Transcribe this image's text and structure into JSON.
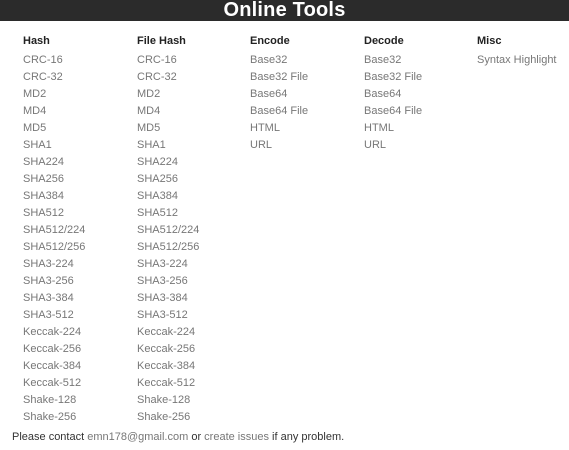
{
  "header": {
    "title": "Online Tools"
  },
  "hash": {
    "title": "Hash",
    "items": [
      "CRC-16",
      "CRC-32",
      "MD2",
      "MD4",
      "MD5",
      "SHA1",
      "SHA224",
      "SHA256",
      "SHA384",
      "SHA512",
      "SHA512/224",
      "SHA512/256",
      "SHA3-224",
      "SHA3-256",
      "SHA3-384",
      "SHA3-512",
      "Keccak-224",
      "Keccak-256",
      "Keccak-384",
      "Keccak-512",
      "Shake-128",
      "Shake-256"
    ]
  },
  "file_hash": {
    "title": "File Hash",
    "items": [
      "CRC-16",
      "CRC-32",
      "MD2",
      "MD4",
      "MD5",
      "SHA1",
      "SHA224",
      "SHA256",
      "SHA384",
      "SHA512",
      "SHA512/224",
      "SHA512/256",
      "SHA3-224",
      "SHA3-256",
      "SHA3-384",
      "SHA3-512",
      "Keccak-224",
      "Keccak-256",
      "Keccak-384",
      "Keccak-512",
      "Shake-128",
      "Shake-256"
    ]
  },
  "encode": {
    "title": "Encode",
    "items": [
      "Base32",
      "Base32 File",
      "Base64",
      "Base64 File",
      "HTML",
      "URL"
    ]
  },
  "decode": {
    "title": "Decode",
    "items": [
      "Base32",
      "Base32 File",
      "Base64",
      "Base64 File",
      "HTML",
      "URL"
    ]
  },
  "misc": {
    "title": "Misc",
    "items": [
      "Syntax Highlight"
    ]
  },
  "footer": {
    "prefix": "Please contact ",
    "email": "emn178@gmail.com",
    "middle": " or ",
    "issues_link": "create issues",
    "suffix": " if any problem."
  },
  "colors": {
    "header_bg": "#2b2b2b",
    "link": "#777777",
    "heading": "#222222"
  }
}
